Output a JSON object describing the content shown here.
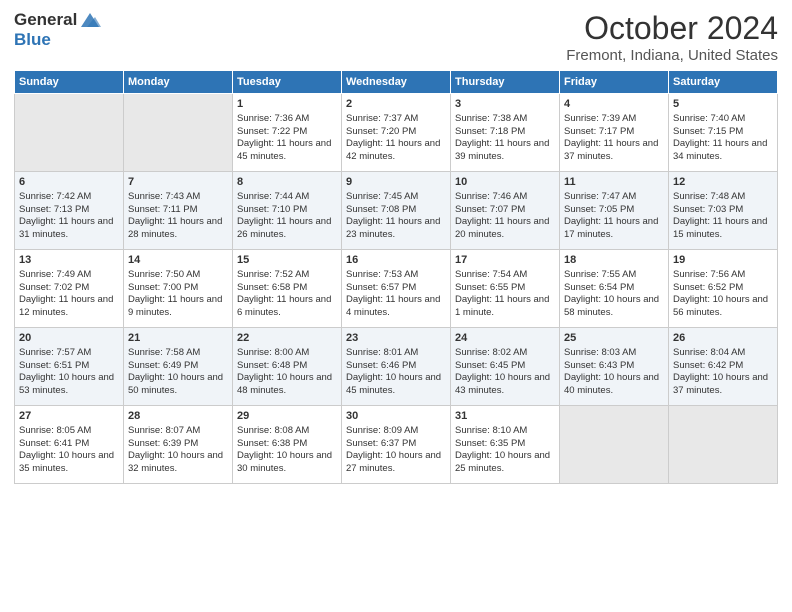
{
  "logo": {
    "general": "General",
    "blue": "Blue"
  },
  "title": "October 2024",
  "subtitle": "Fremont, Indiana, United States",
  "headers": [
    "Sunday",
    "Monday",
    "Tuesday",
    "Wednesday",
    "Thursday",
    "Friday",
    "Saturday"
  ],
  "weeks": [
    [
      {
        "day": "",
        "sunrise": "",
        "sunset": "",
        "daylight": "",
        "empty": true
      },
      {
        "day": "",
        "sunrise": "",
        "sunset": "",
        "daylight": "",
        "empty": true
      },
      {
        "day": "1",
        "sunrise": "Sunrise: 7:36 AM",
        "sunset": "Sunset: 7:22 PM",
        "daylight": "Daylight: 11 hours and 45 minutes."
      },
      {
        "day": "2",
        "sunrise": "Sunrise: 7:37 AM",
        "sunset": "Sunset: 7:20 PM",
        "daylight": "Daylight: 11 hours and 42 minutes."
      },
      {
        "day": "3",
        "sunrise": "Sunrise: 7:38 AM",
        "sunset": "Sunset: 7:18 PM",
        "daylight": "Daylight: 11 hours and 39 minutes."
      },
      {
        "day": "4",
        "sunrise": "Sunrise: 7:39 AM",
        "sunset": "Sunset: 7:17 PM",
        "daylight": "Daylight: 11 hours and 37 minutes."
      },
      {
        "day": "5",
        "sunrise": "Sunrise: 7:40 AM",
        "sunset": "Sunset: 7:15 PM",
        "daylight": "Daylight: 11 hours and 34 minutes."
      }
    ],
    [
      {
        "day": "6",
        "sunrise": "Sunrise: 7:42 AM",
        "sunset": "Sunset: 7:13 PM",
        "daylight": "Daylight: 11 hours and 31 minutes."
      },
      {
        "day": "7",
        "sunrise": "Sunrise: 7:43 AM",
        "sunset": "Sunset: 7:11 PM",
        "daylight": "Daylight: 11 hours and 28 minutes."
      },
      {
        "day": "8",
        "sunrise": "Sunrise: 7:44 AM",
        "sunset": "Sunset: 7:10 PM",
        "daylight": "Daylight: 11 hours and 26 minutes."
      },
      {
        "day": "9",
        "sunrise": "Sunrise: 7:45 AM",
        "sunset": "Sunset: 7:08 PM",
        "daylight": "Daylight: 11 hours and 23 minutes."
      },
      {
        "day": "10",
        "sunrise": "Sunrise: 7:46 AM",
        "sunset": "Sunset: 7:07 PM",
        "daylight": "Daylight: 11 hours and 20 minutes."
      },
      {
        "day": "11",
        "sunrise": "Sunrise: 7:47 AM",
        "sunset": "Sunset: 7:05 PM",
        "daylight": "Daylight: 11 hours and 17 minutes."
      },
      {
        "day": "12",
        "sunrise": "Sunrise: 7:48 AM",
        "sunset": "Sunset: 7:03 PM",
        "daylight": "Daylight: 11 hours and 15 minutes."
      }
    ],
    [
      {
        "day": "13",
        "sunrise": "Sunrise: 7:49 AM",
        "sunset": "Sunset: 7:02 PM",
        "daylight": "Daylight: 11 hours and 12 minutes."
      },
      {
        "day": "14",
        "sunrise": "Sunrise: 7:50 AM",
        "sunset": "Sunset: 7:00 PM",
        "daylight": "Daylight: 11 hours and 9 minutes."
      },
      {
        "day": "15",
        "sunrise": "Sunrise: 7:52 AM",
        "sunset": "Sunset: 6:58 PM",
        "daylight": "Daylight: 11 hours and 6 minutes."
      },
      {
        "day": "16",
        "sunrise": "Sunrise: 7:53 AM",
        "sunset": "Sunset: 6:57 PM",
        "daylight": "Daylight: 11 hours and 4 minutes."
      },
      {
        "day": "17",
        "sunrise": "Sunrise: 7:54 AM",
        "sunset": "Sunset: 6:55 PM",
        "daylight": "Daylight: 11 hours and 1 minute."
      },
      {
        "day": "18",
        "sunrise": "Sunrise: 7:55 AM",
        "sunset": "Sunset: 6:54 PM",
        "daylight": "Daylight: 10 hours and 58 minutes."
      },
      {
        "day": "19",
        "sunrise": "Sunrise: 7:56 AM",
        "sunset": "Sunset: 6:52 PM",
        "daylight": "Daylight: 10 hours and 56 minutes."
      }
    ],
    [
      {
        "day": "20",
        "sunrise": "Sunrise: 7:57 AM",
        "sunset": "Sunset: 6:51 PM",
        "daylight": "Daylight: 10 hours and 53 minutes."
      },
      {
        "day": "21",
        "sunrise": "Sunrise: 7:58 AM",
        "sunset": "Sunset: 6:49 PM",
        "daylight": "Daylight: 10 hours and 50 minutes."
      },
      {
        "day": "22",
        "sunrise": "Sunrise: 8:00 AM",
        "sunset": "Sunset: 6:48 PM",
        "daylight": "Daylight: 10 hours and 48 minutes."
      },
      {
        "day": "23",
        "sunrise": "Sunrise: 8:01 AM",
        "sunset": "Sunset: 6:46 PM",
        "daylight": "Daylight: 10 hours and 45 minutes."
      },
      {
        "day": "24",
        "sunrise": "Sunrise: 8:02 AM",
        "sunset": "Sunset: 6:45 PM",
        "daylight": "Daylight: 10 hours and 43 minutes."
      },
      {
        "day": "25",
        "sunrise": "Sunrise: 8:03 AM",
        "sunset": "Sunset: 6:43 PM",
        "daylight": "Daylight: 10 hours and 40 minutes."
      },
      {
        "day": "26",
        "sunrise": "Sunrise: 8:04 AM",
        "sunset": "Sunset: 6:42 PM",
        "daylight": "Daylight: 10 hours and 37 minutes."
      }
    ],
    [
      {
        "day": "27",
        "sunrise": "Sunrise: 8:05 AM",
        "sunset": "Sunset: 6:41 PM",
        "daylight": "Daylight: 10 hours and 35 minutes."
      },
      {
        "day": "28",
        "sunrise": "Sunrise: 8:07 AM",
        "sunset": "Sunset: 6:39 PM",
        "daylight": "Daylight: 10 hours and 32 minutes."
      },
      {
        "day": "29",
        "sunrise": "Sunrise: 8:08 AM",
        "sunset": "Sunset: 6:38 PM",
        "daylight": "Daylight: 10 hours and 30 minutes."
      },
      {
        "day": "30",
        "sunrise": "Sunrise: 8:09 AM",
        "sunset": "Sunset: 6:37 PM",
        "daylight": "Daylight: 10 hours and 27 minutes."
      },
      {
        "day": "31",
        "sunrise": "Sunrise: 8:10 AM",
        "sunset": "Sunset: 6:35 PM",
        "daylight": "Daylight: 10 hours and 25 minutes."
      },
      {
        "day": "",
        "sunrise": "",
        "sunset": "",
        "daylight": "",
        "empty": true
      },
      {
        "day": "",
        "sunrise": "",
        "sunset": "",
        "daylight": "",
        "empty": true
      }
    ]
  ]
}
